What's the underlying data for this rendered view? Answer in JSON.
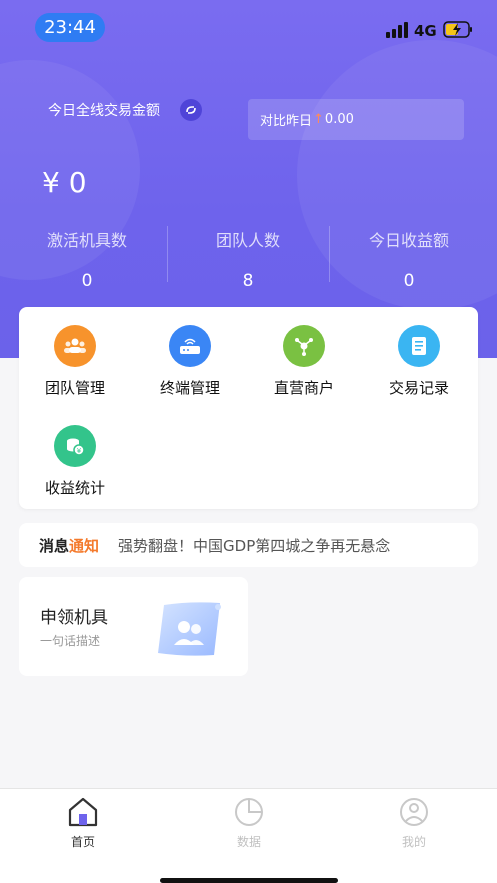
{
  "status_bar": {
    "time": "23:44",
    "network": "4G"
  },
  "header": {
    "title": "今日全线交易金额",
    "compare_prefix": "对比昨日",
    "compare_arrow": "↑",
    "compare_value": "0.00",
    "amount": "¥ 0"
  },
  "stats": [
    {
      "label": "激活机具数",
      "value": "0"
    },
    {
      "label": "团队人数",
      "value": "8"
    },
    {
      "label": "今日收益额",
      "value": "0"
    }
  ],
  "menu": [
    {
      "label": "团队管理",
      "icon": "team-icon",
      "color": "#f7932c"
    },
    {
      "label": "终端管理",
      "icon": "terminal-icon",
      "color": "#3a86f5"
    },
    {
      "label": "直营商户",
      "icon": "merchant-icon",
      "color": "#7ac142"
    },
    {
      "label": "交易记录",
      "icon": "record-icon",
      "color": "#3ab5f2"
    },
    {
      "label": "收益统计",
      "icon": "earnings-icon",
      "color": "#33c48b"
    }
  ],
  "notice": {
    "tag_a": "消息",
    "tag_b": "通知",
    "message": "强势翻盘！中国GDP第四城之争再无悬念"
  },
  "apply_card": {
    "title": "申领机具",
    "subtitle": "一句话描述"
  },
  "tabs": [
    {
      "label": "首页",
      "icon": "home-icon",
      "active": true
    },
    {
      "label": "数据",
      "icon": "pie-chart-icon",
      "active": false
    },
    {
      "label": "我的",
      "icon": "user-icon",
      "active": false
    }
  ],
  "colors": {
    "accent": "#6e63ec",
    "notice_highlight": "#f47a2c"
  }
}
